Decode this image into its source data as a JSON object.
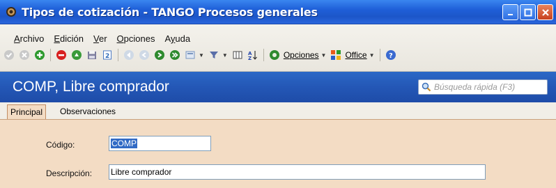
{
  "window": {
    "title": "Tipos de cotización - TANGO Procesos generales"
  },
  "menu": [
    {
      "label": "Archivo",
      "accel": "A"
    },
    {
      "label": "Edición",
      "accel": "E"
    },
    {
      "label": "Ver",
      "accel": "V"
    },
    {
      "label": "Opciones",
      "accel": "O"
    },
    {
      "label": "Ayuda",
      "accel": "y"
    }
  ],
  "toolbar": {
    "opciones_label": "Opciones",
    "office_label": "Office",
    "icons": [
      "confirm-icon",
      "cancel-icon",
      "add-icon",
      "delete-icon",
      "modify-icon",
      "save-icon",
      "export-icon",
      "first-icon",
      "previous-icon",
      "next-icon",
      "last-icon",
      "view-icon",
      "filter-icon",
      "columns-icon",
      "sort-icon",
      "options-icon",
      "office-icon",
      "help-icon"
    ]
  },
  "header": {
    "title": "COMP, Libre comprador",
    "search_placeholder": "Búsqueda rápida (F3)"
  },
  "tabs": [
    {
      "label": "Principal",
      "active": true
    },
    {
      "label": "Observaciones",
      "active": false
    }
  ],
  "form": {
    "codigo_label": "Código:",
    "codigo_value": "COMP",
    "descripcion_label": "Descripción:",
    "descripcion_value": "Libre comprador"
  },
  "colors": {
    "titlebar": "#1f5fd8",
    "header_band": "#2457b6",
    "form_bg": "#f3dcc4"
  }
}
